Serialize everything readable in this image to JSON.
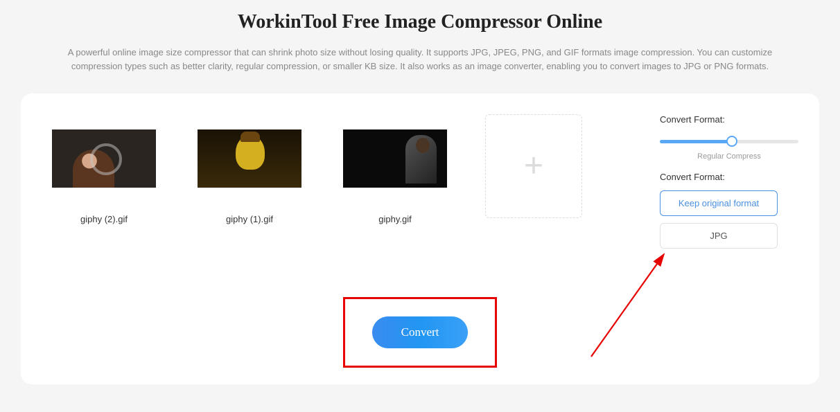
{
  "header": {
    "title": "WorkinTool Free Image Compressor Online",
    "description": "A powerful online image size compressor that can shrink photo size without losing quality. It supports JPG, JPEG, PNG, and GIF formats image compression. You can customize compression types such as better clarity, regular compression, or smaller KB size. It also works as an image converter, enabling you to convert images to JPG or PNG formats."
  },
  "files": [
    {
      "name": "giphy (2).gif"
    },
    {
      "name": "giphy (1).gif"
    },
    {
      "name": "giphy.gif"
    }
  ],
  "sidebar": {
    "compress_label": "Convert Format:",
    "slider_value_label": "Regular Compress",
    "format_label": "Convert Format:",
    "options": {
      "keep": "Keep original format",
      "jpg": "JPG"
    }
  },
  "actions": {
    "convert": "Convert"
  }
}
